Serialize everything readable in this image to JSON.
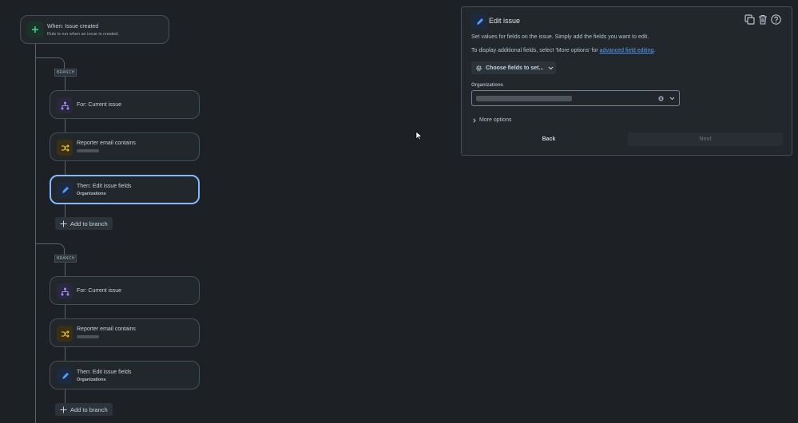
{
  "trigger": {
    "title": "When: Issue created",
    "subtitle": "Rule is run when an issue is created."
  },
  "branches": [
    {
      "tag": "BRANCH",
      "for_label": "For: Current issue",
      "condition_label": "Reporter email contains",
      "action_title": "Then: Edit issue fields",
      "action_sub": "Organizations",
      "add_label": "Add to branch"
    },
    {
      "tag": "BRANCH",
      "for_label": "For: Current issue",
      "condition_label": "Reporter email contains",
      "action_title": "Then: Edit issue fields",
      "action_sub": "Organizations",
      "add_label": "Add to branch"
    }
  ],
  "panel": {
    "title": "Edit issue",
    "description": "Set values for fields on the issue. Simply add the fields you want to edit.",
    "advanced_prefix": "To display additional fields, select 'More options' for ",
    "advanced_link": "advanced field editing",
    "advanced_suffix": ".",
    "choose_fields_label": "Choose fields to set...",
    "org_label": "Organizations",
    "more_options_label": "More options",
    "back_label": "Back",
    "next_label": "Next"
  },
  "icons": {
    "trigger": "plus-icon",
    "branch": "hierarchy-icon",
    "condition": "shuffle-icon",
    "action": "pencil-icon",
    "copy": "copy-icon",
    "delete": "trash-icon",
    "help": "help-icon",
    "gear": "gear-icon",
    "cursor": "mouse-cursor-icon"
  },
  "colors": {
    "background": "#1d2125",
    "card": "#22272b",
    "trigger_green": "#4bce97",
    "branch_purple": "#9f8fef",
    "condition_yellow": "#f5cd47",
    "action_blue": "#579dff",
    "link_blue": "#579dff"
  }
}
